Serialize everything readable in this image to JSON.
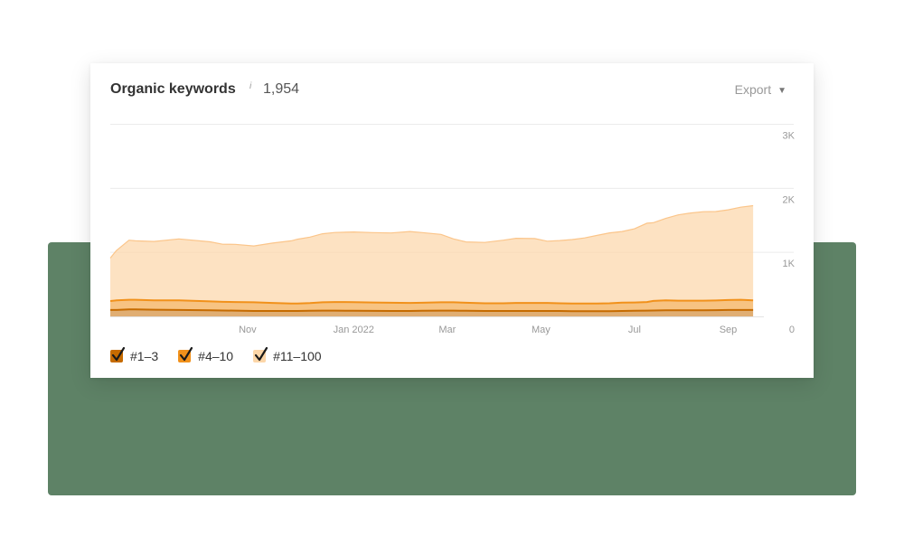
{
  "header": {
    "title": "Organic keywords",
    "info_icon": "i",
    "count": "1,954",
    "export_label": "Export",
    "export_caret": "▼"
  },
  "colors": {
    "top3": "#c66b00",
    "top10": "#f1911b",
    "top100": "#fcd6a8",
    "background_panel": "#5e8266"
  },
  "chart_data": {
    "type": "area",
    "stacked": true,
    "title": "",
    "xlabel": "",
    "ylabel": "",
    "ylim": [
      0,
      3000
    ],
    "y_ticks": [
      "0",
      "1K",
      "2K",
      "3K"
    ],
    "y_axis_side": "right",
    "grid": true,
    "x_tick_labels": [
      "Nov",
      "Jan 2022",
      "Mar",
      "May",
      "Jul",
      "Sep"
    ],
    "x_ticks_at": [
      22,
      39,
      54,
      69,
      84,
      99
    ],
    "x_range": [
      0,
      104
    ],
    "x": [
      0,
      1,
      3,
      4,
      7,
      11,
      16,
      18,
      20,
      23,
      26,
      29,
      30,
      32,
      34,
      36,
      39,
      42,
      45,
      48,
      50,
      53,
      55,
      57,
      60,
      63,
      65,
      68,
      70,
      72,
      74,
      76,
      78,
      80,
      82,
      84,
      86,
      87,
      89,
      91,
      93,
      95,
      97,
      99,
      101,
      103
    ],
    "series": [
      {
        "name": "#1–3",
        "values": [
          100,
          100,
          110,
          110,
          105,
          100,
          95,
          92,
          90,
          85,
          85,
          85,
          85,
          88,
          90,
          90,
          88,
          86,
          85,
          85,
          88,
          90,
          90,
          88,
          85,
          85,
          85,
          85,
          85,
          85,
          80,
          80,
          80,
          80,
          85,
          88,
          90,
          92,
          95,
          95,
          95,
          95,
          98,
          100,
          100,
          100
        ]
      },
      {
        "name": "#4–10",
        "values": [
          140,
          150,
          150,
          150,
          145,
          150,
          140,
          135,
          135,
          135,
          125,
          115,
          115,
          120,
          130,
          135,
          135,
          132,
          128,
          125,
          125,
          130,
          130,
          125,
          120,
          120,
          125,
          125,
          125,
          120,
          120,
          120,
          120,
          125,
          130,
          130,
          135,
          150,
          155,
          150,
          150,
          150,
          150,
          155,
          160,
          150
        ]
      },
      {
        "name": "#11–100",
        "values": [
          670,
          780,
          930,
          920,
          920,
          960,
          930,
          900,
          900,
          880,
          935,
          980,
          1005,
          1030,
          1070,
          1085,
          1095,
          1090,
          1090,
          1115,
          1095,
          1060,
          990,
          950,
          950,
          985,
          1010,
          1005,
          965,
          980,
          1000,
          1025,
          1065,
          1100,
          1110,
          1150,
          1230,
          1220,
          1280,
          1340,
          1370,
          1390,
          1390,
          1410,
          1445,
          1480
        ]
      }
    ]
  },
  "legend": [
    {
      "label": "#1–3",
      "checked": true
    },
    {
      "label": "#4–10",
      "checked": true
    },
    {
      "label": "#11–100",
      "checked": true
    }
  ]
}
